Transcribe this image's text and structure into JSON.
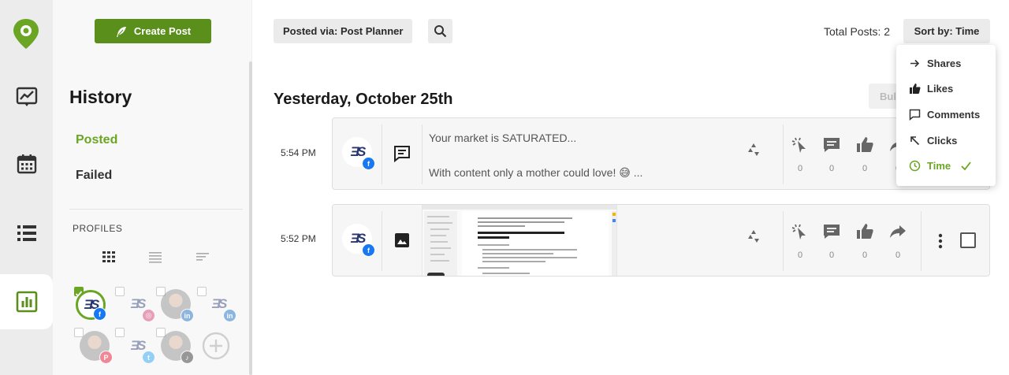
{
  "brand": {
    "accent": "#6aa524",
    "button": "#5a8f1b"
  },
  "rail": {
    "items": [
      {
        "name": "analytics-icon"
      },
      {
        "name": "calendar-icon"
      },
      {
        "name": "list-icon"
      },
      {
        "name": "history-chart-icon",
        "active": true
      }
    ]
  },
  "sidebar": {
    "create_label": "Create Post",
    "history_title": "History",
    "nav": {
      "posted": "Posted",
      "failed": "Failed"
    },
    "profiles_label": "PROFILES",
    "profiles": [
      {
        "network": "facebook",
        "selected": true
      },
      {
        "network": "instagram"
      },
      {
        "network": "linkedin"
      },
      {
        "network": "linkedin"
      },
      {
        "network": "pinterest"
      },
      {
        "network": "twitter"
      },
      {
        "network": "tiktok"
      }
    ]
  },
  "toolbar": {
    "posted_via": "Posted via: Post Planner",
    "total_posts": "Total Posts: 2",
    "sort_label": "Sort by: Time"
  },
  "feed": {
    "date_heading": "Yesterday, October 25th",
    "bulk_label": "Bulk",
    "posts": [
      {
        "time": "5:54 PM",
        "type": "text",
        "line1": "Your market is SATURATED...",
        "line2": "With content only a mother could love! 😅 ...",
        "metrics": [
          "0",
          "0",
          "0",
          "0"
        ]
      },
      {
        "time": "5:52 PM",
        "type": "image",
        "metrics": [
          "0",
          "0",
          "0",
          "0"
        ]
      }
    ]
  },
  "sort_menu": {
    "items": [
      {
        "label": "Shares",
        "icon": "arrow-right-icon"
      },
      {
        "label": "Likes",
        "icon": "thumbs-up-icon"
      },
      {
        "label": "Comments",
        "icon": "comment-icon"
      },
      {
        "label": "Clicks",
        "icon": "arrow-up-left-icon"
      },
      {
        "label": "Time",
        "icon": "clock-icon",
        "active": true
      }
    ]
  }
}
